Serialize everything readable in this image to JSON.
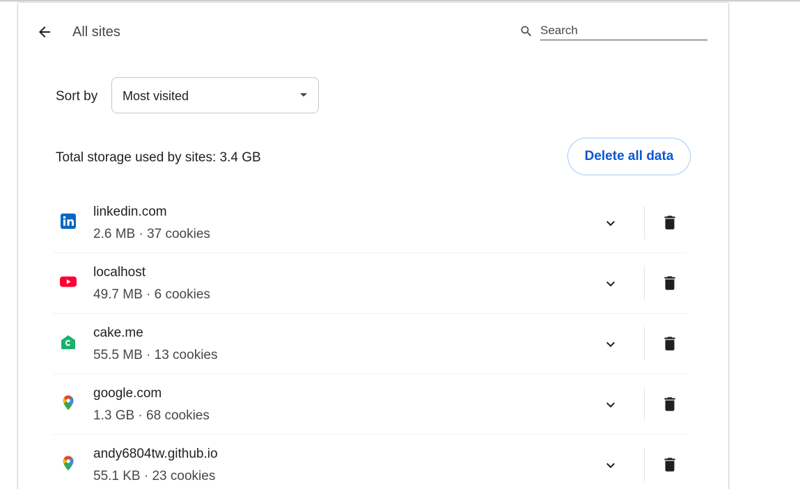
{
  "header": {
    "title": "All sites",
    "search_placeholder": "Search"
  },
  "sort": {
    "label": "Sort by",
    "selected": "Most visited"
  },
  "storage": {
    "summary": "Total storage used by sites: 3.4 GB",
    "delete_all_label": "Delete all data"
  },
  "sites": [
    {
      "name": "linkedin.com",
      "meta": "2.6 MB · 37 cookies",
      "icon": "linkedin-icon"
    },
    {
      "name": "localhost",
      "meta": "49.7 MB · 6 cookies",
      "icon": "youtube-icon"
    },
    {
      "name": "cake.me",
      "meta": "55.5 MB · 13 cookies",
      "icon": "cake-icon"
    },
    {
      "name": "google.com",
      "meta": "1.3 GB · 68 cookies",
      "icon": "google-maps-pin-icon"
    },
    {
      "name": "andy6804tw.github.io",
      "meta": "55.1 KB · 23 cookies",
      "icon": "google-maps-pin-icon"
    }
  ],
  "colors": {
    "accent": "#0b57d0",
    "button_border": "#a8c7fa",
    "linkedin": "#0a66c2",
    "youtube": "#ff0033",
    "cake": "#18b26b"
  }
}
